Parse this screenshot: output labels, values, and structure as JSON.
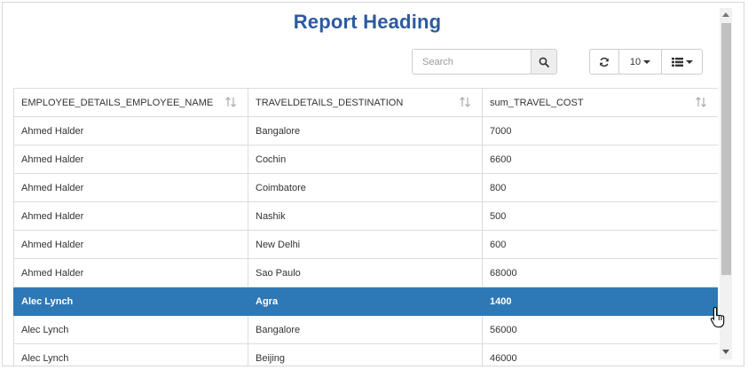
{
  "report": {
    "title": "Report Heading"
  },
  "toolbar": {
    "search_placeholder": "Search",
    "page_size": "10",
    "icons": {
      "search": "search-icon",
      "refresh": "refresh-icon",
      "columns": "list-columns-icon"
    }
  },
  "table": {
    "columns": [
      "EMPLOYEE_DETAILS_EMPLOYEE_NAME",
      "TRAVELDETAILS_DESTINATION",
      "sum_TRAVEL_COST"
    ],
    "rows": [
      [
        "Ahmed Halder",
        "Bangalore",
        "7000"
      ],
      [
        "Ahmed Halder",
        "Cochin",
        "6600"
      ],
      [
        "Ahmed Halder",
        "Coimbatore",
        "800"
      ],
      [
        "Ahmed Halder",
        "Nashik",
        "500"
      ],
      [
        "Ahmed Halder",
        "New Delhi",
        "600"
      ],
      [
        "Ahmed Halder",
        "Sao Paulo",
        "68000"
      ],
      [
        "Alec Lynch",
        "Agra",
        "1400"
      ],
      [
        "Alec Lynch",
        "Bangalore",
        "56000"
      ],
      [
        "Alec Lynch",
        "Beijing",
        "46000"
      ]
    ],
    "selected_row_index": 6,
    "selected_color": "#2f78b6"
  },
  "colors": {
    "heading": "#2c5aa0",
    "accent": "#2f78b6"
  }
}
